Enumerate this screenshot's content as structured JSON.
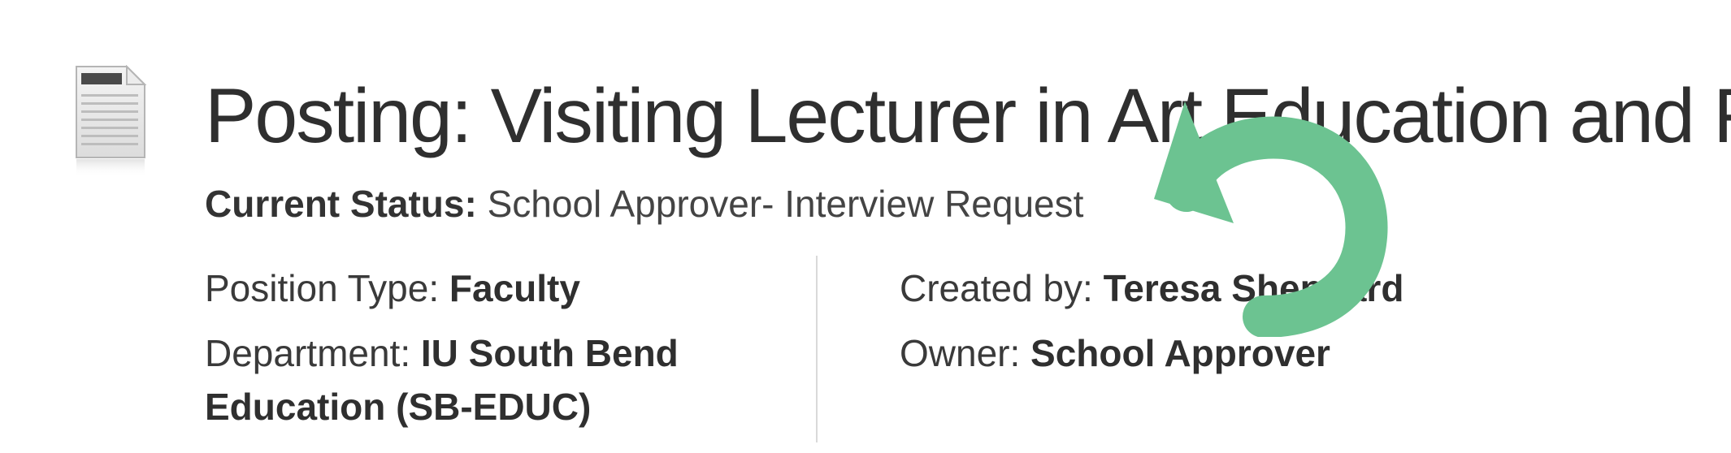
{
  "posting": {
    "title": "Posting: Visiting Lecturer in Art Education and F",
    "status_label": "Current Status:",
    "status_value": "School Approver- Interview Request"
  },
  "details": {
    "position_type_label": "Position Type:",
    "position_type_value": "Faculty",
    "department_label": "Department:",
    "department_value_line1": "IU South Bend",
    "department_value_line2": "Education (SB-EDUC)",
    "created_by_label": "Created by:",
    "created_by_value": "Teresa Sheppard",
    "owner_label": "Owner:",
    "owner_value": "School Approver"
  },
  "icons": {
    "document": "document-icon",
    "overlay": "undo-arrow-icon"
  },
  "colors": {
    "text": "#333333",
    "divider": "#d9d9d9",
    "overlay_green": "#6cc391"
  }
}
